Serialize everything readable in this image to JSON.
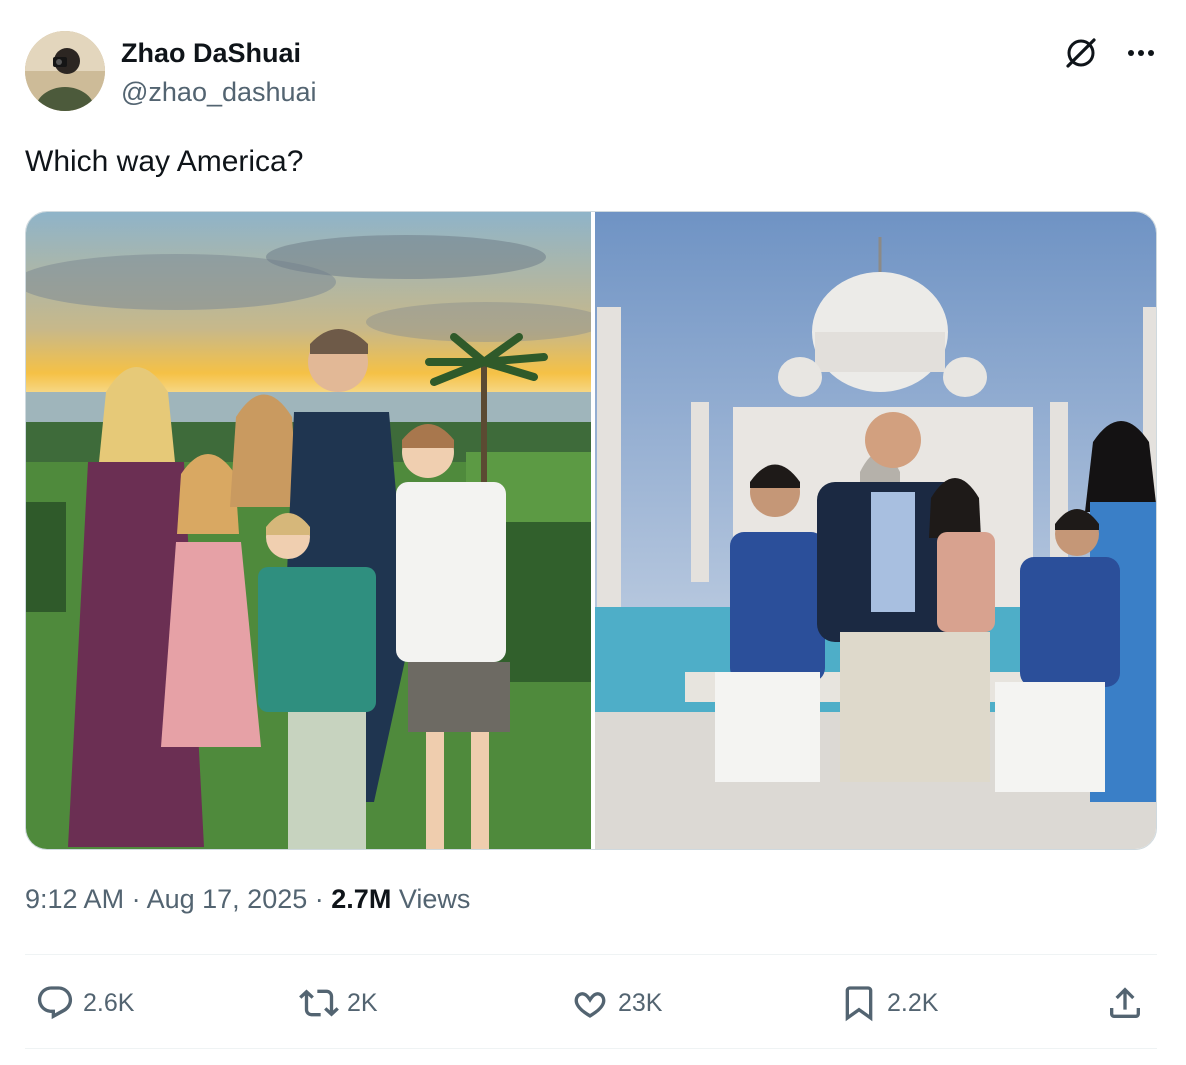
{
  "author": {
    "name": "Zhao DaShuai",
    "handle": "@zhao_dashuai"
  },
  "tweet": {
    "text": "Which way America?"
  },
  "meta": {
    "time": "9:12 AM",
    "sep1": "·",
    "date": "Aug 17, 2025",
    "sep2": "·",
    "views_count": "2.7M",
    "views_label": "Views"
  },
  "actions": {
    "replies": "2.6K",
    "reposts": "2K",
    "likes": "23K",
    "bookmarks": "2.2K"
  },
  "icons": {
    "grok": "grok-icon",
    "more": "more-icon",
    "reply": "reply-icon",
    "repost": "repost-icon",
    "like": "heart-icon",
    "bookmark": "bookmark-icon",
    "share": "share-icon"
  },
  "colors": {
    "text_primary": "#0f1419",
    "text_secondary": "#536471",
    "border": "#cfd9de"
  }
}
